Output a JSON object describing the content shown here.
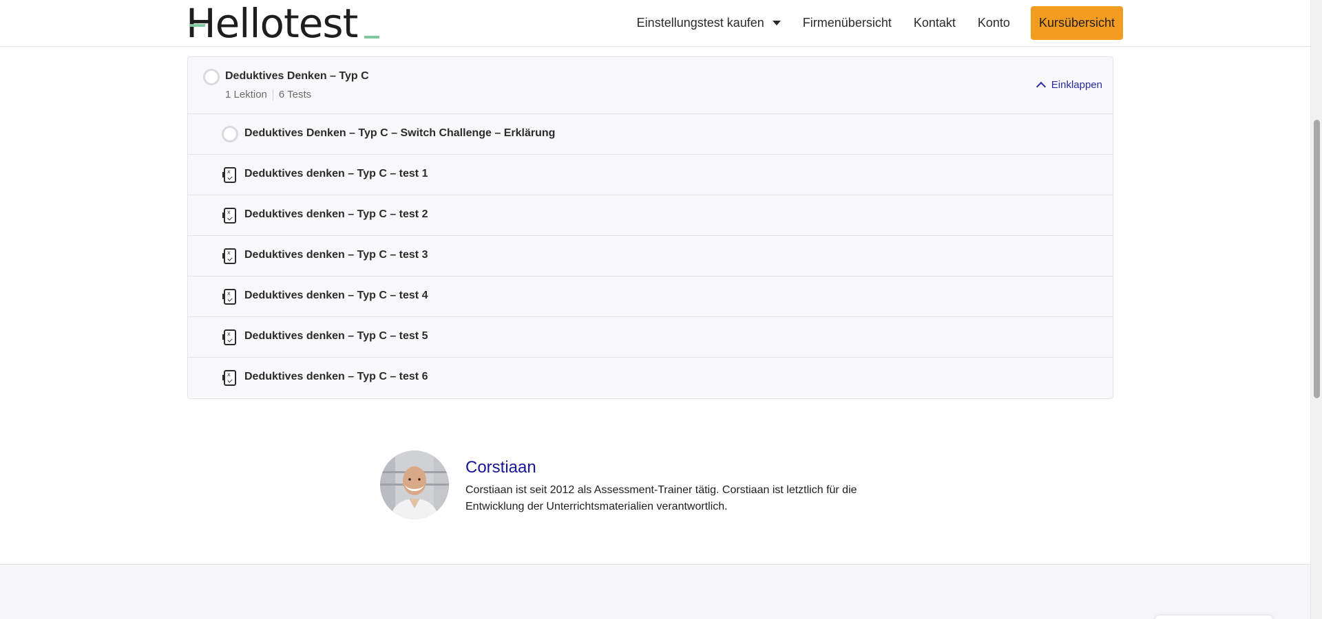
{
  "header": {
    "logo_text": "Hellotest",
    "nav": {
      "buy": "Einstellungstest kaufen",
      "companies": "Firmenübersicht",
      "contact": "Kontakt",
      "account": "Konto",
      "courses": "Kursübersicht"
    },
    "accent_color": "#f39c1f"
  },
  "section": {
    "title": "Deduktives Denken – Typ C",
    "lessons": "1 Lektion",
    "tests": "6 Tests",
    "collapse_label": "Einklappen",
    "items": [
      {
        "label": "Deduktives Denken – Typ C – Switch Challenge – Erklärung",
        "icon": "lesson-circle-icon"
      },
      {
        "label": "Deduktives denken – Typ C – test 1",
        "icon": "quiz-icon"
      },
      {
        "label": "Deduktives denken – Typ C – test 2",
        "icon": "quiz-icon"
      },
      {
        "label": "Deduktives denken – Typ C – test 3",
        "icon": "quiz-icon"
      },
      {
        "label": "Deduktives denken – Typ C – test 4",
        "icon": "quiz-icon"
      },
      {
        "label": "Deduktives denken – Typ C – test 5",
        "icon": "quiz-icon"
      },
      {
        "label": "Deduktives denken – Typ C – test 6",
        "icon": "quiz-icon"
      }
    ]
  },
  "instructor": {
    "name": "Corstiaan",
    "bio": "Corstiaan ist seit 2012 als Assessment-Trainer tätig. Corstiaan ist letztlich für die Entwicklung der Unterrichtsmaterialien verantwortlich.",
    "name_color": "#16169a"
  }
}
